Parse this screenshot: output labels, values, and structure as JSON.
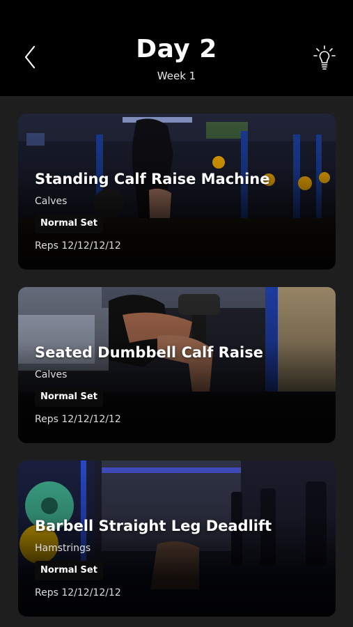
{
  "header": {
    "title": "Day 2",
    "subtitle": "Week 1",
    "back_icon": "chevron-left-icon",
    "tips_icon": "lightbulb-icon"
  },
  "exercises": [
    {
      "name": "Standing Calf Raise Machine",
      "muscle": "Calves",
      "set_type": "Normal Set",
      "reps": "Reps 12/12/12/12"
    },
    {
      "name": "Seated Dumbbell Calf Raise",
      "muscle": "Calves",
      "set_type": "Normal Set",
      "reps": "Reps 12/12/12/12"
    },
    {
      "name": "Barbell Straight Leg Deadlift",
      "muscle": "Hamstrings",
      "set_type": "Normal Set",
      "reps": "Reps 12/12/12/12"
    }
  ],
  "colors": {
    "background": "#1e1e1e",
    "header": "#000000",
    "text": "#ffffff"
  }
}
